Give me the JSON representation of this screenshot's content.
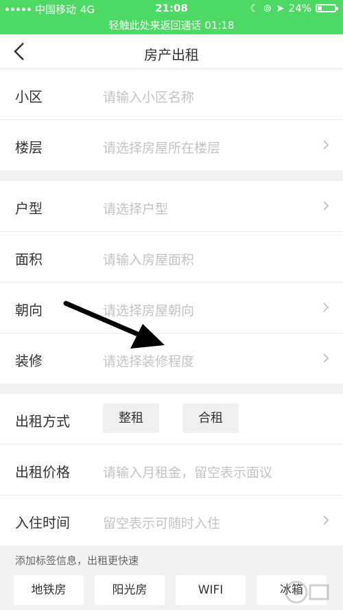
{
  "status": {
    "carrier": "中国移动",
    "network": "4G",
    "time": "21:08",
    "battery": "24%",
    "battery_level": 0.24,
    "call_banner": "轻触此处来返回通话 01:18"
  },
  "nav": {
    "title": "房产出租"
  },
  "group1": [
    {
      "label": "小区",
      "placeholder": "请输入小区名称"
    },
    {
      "label": "楼层",
      "placeholder": "请选择房屋所在楼层"
    }
  ],
  "group2": [
    {
      "label": "户型",
      "placeholder": "请选择户型"
    },
    {
      "label": "面积",
      "placeholder": "请输入房屋面积"
    },
    {
      "label": "朝向",
      "placeholder": "请选择房屋朝向"
    },
    {
      "label": "装修",
      "placeholder": "请选择装修程度"
    }
  ],
  "group3": {
    "rent_mode": {
      "label": "出租方式",
      "options": [
        "整租",
        "合租"
      ]
    },
    "rent_price": {
      "label": "出租价格",
      "placeholder": "请输入月租金，留空表示面议"
    },
    "move_in": {
      "label": "入住时间",
      "placeholder": "留空表示可随时入住"
    }
  },
  "tags": {
    "hint": "添加标签信息，出租更快速",
    "items": [
      "地铁房",
      "阳光房",
      "WIFI",
      "冰箱"
    ]
  },
  "colors": {
    "statusbar": "#4cd964"
  }
}
